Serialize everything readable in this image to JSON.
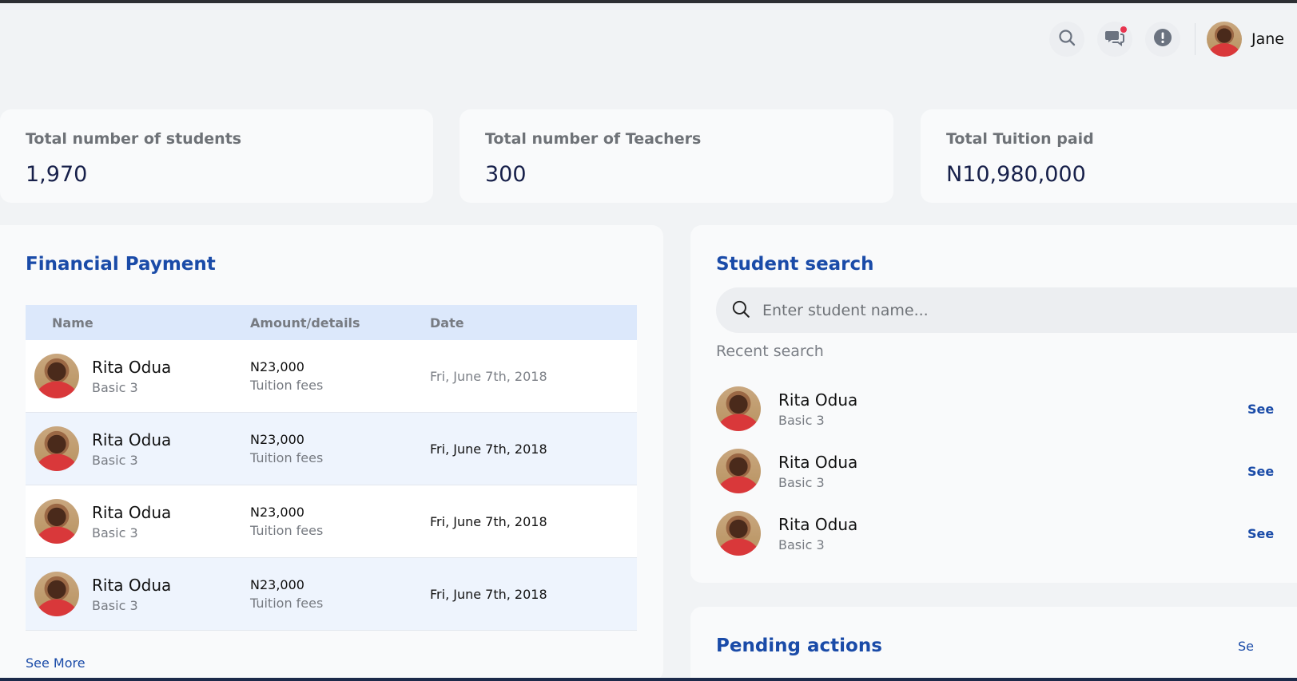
{
  "header": {
    "user_name": "Jane",
    "icons": [
      "search-icon",
      "chat-icon",
      "alert-icon"
    ],
    "has_unread_messages": true
  },
  "stats": [
    {
      "label": "Total number of students",
      "value": "1,970"
    },
    {
      "label": "Total number of Teachers",
      "value": "300"
    },
    {
      "label": "Total Tuition paid",
      "value": "N10,980,000"
    }
  ],
  "financial": {
    "title": "Financial Payment",
    "columns": [
      "Name",
      "Amount/details",
      "Date"
    ],
    "rows": [
      {
        "name": "Rita Odua",
        "class": "Basic 3",
        "amount": "N23,000",
        "details": "Tuition fees",
        "date": "Fri, June 7th, 2018"
      },
      {
        "name": "Rita Odua",
        "class": "Basic 3",
        "amount": "N23,000",
        "details": "Tuition fees",
        "date": "Fri, June 7th, 2018"
      },
      {
        "name": "Rita Odua",
        "class": "Basic 3",
        "amount": "N23,000",
        "details": "Tuition fees",
        "date": "Fri, June 7th, 2018"
      },
      {
        "name": "Rita Odua",
        "class": "Basic 3",
        "amount": "N23,000",
        "details": "Tuition fees",
        "date": "Fri, June 7th, 2018"
      }
    ],
    "see_more": "See More"
  },
  "student_search": {
    "title": "Student search",
    "placeholder": "Enter student name...",
    "recent_label": "Recent search",
    "recent": [
      {
        "name": "Rita Odua",
        "class": "Basic 3",
        "link": "See"
      },
      {
        "name": "Rita Odua",
        "class": "Basic 3",
        "link": "See"
      },
      {
        "name": "Rita Odua",
        "class": "Basic 3",
        "link": "See"
      }
    ]
  },
  "pending": {
    "title": "Pending actions",
    "link": "Se"
  },
  "colors": {
    "accent": "#1a4ba8",
    "table_header": "#dce8fb",
    "notification_dot": "#e8344e"
  }
}
